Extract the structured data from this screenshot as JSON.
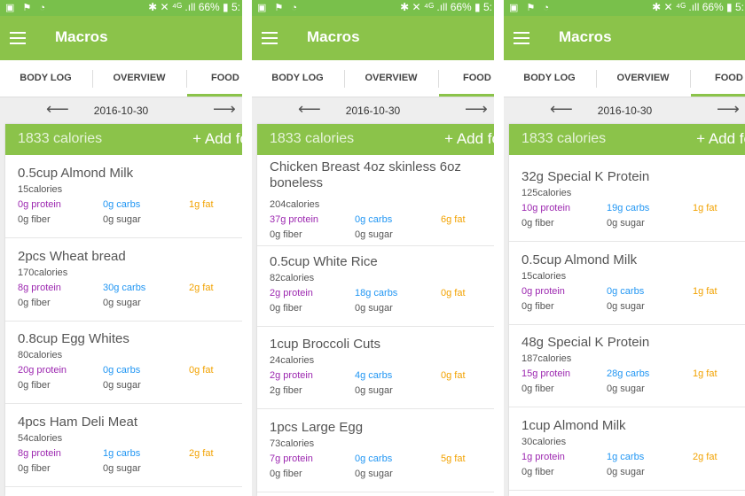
{
  "status": {
    "left_icons": "▣ ⚑ ◔",
    "right": "✱ ✕ ⁴ᴳ .ıll 66% ▮ 5:"
  },
  "app": {
    "title": "Macros"
  },
  "tabs": [
    "BODY LOG",
    "OVERVIEW",
    "FOOD L"
  ],
  "date": "2016-10-30",
  "header": {
    "calories": "1833 calories",
    "add_food": "+ Add fo"
  },
  "panels": [
    {
      "items": [
        {
          "name": "0.5cup  Almond Milk",
          "calories": "15calories",
          "protein": "0g protein",
          "carbs": "0g carbs",
          "fat": "1g fat",
          "fiber": "0g fiber",
          "sugar": "0g sugar"
        },
        {
          "name": "2pcs  Wheat bread",
          "calories": "170calories",
          "protein": "8g protein",
          "carbs": "30g carbs",
          "fat": "2g fat",
          "fiber": "0g fiber",
          "sugar": "0g sugar"
        },
        {
          "name": "0.8cup  Egg Whites",
          "calories": "80calories",
          "protein": "20g protein",
          "carbs": "0g carbs",
          "fat": "0g fat",
          "fiber": "0g fiber",
          "sugar": "0g sugar"
        },
        {
          "name": "4pcs  Ham Deli Meat",
          "calories": "54calories",
          "protein": "8g protein",
          "carbs": "1g carbs",
          "fat": "2g fat",
          "fiber": "0g fiber",
          "sugar": "0g sugar"
        }
      ]
    },
    {
      "items": [
        {
          "name": "      Chicken Breast 4oz skinless 6oz  boneless",
          "calories": "204calories",
          "protein": "37g protein",
          "carbs": "0g carbs",
          "fat": "6g fat",
          "fiber": "0g fiber",
          "sugar": "0g sugar"
        },
        {
          "name": "0.5cup  White Rice",
          "calories": "82calories",
          "protein": "2g protein",
          "carbs": "18g carbs",
          "fat": "0g fat",
          "fiber": "0g fiber",
          "sugar": "0g sugar"
        },
        {
          "name": "1cup  Broccoli Cuts",
          "calories": "24calories",
          "protein": "2g protein",
          "carbs": "4g carbs",
          "fat": "0g fat",
          "fiber": "2g fiber",
          "sugar": "0g sugar"
        },
        {
          "name": "1pcs  Large Egg",
          "calories": "73calories",
          "protein": "7g protein",
          "carbs": "0g carbs",
          "fat": "5g fat",
          "fiber": "0g fiber",
          "sugar": "0g sugar"
        }
      ]
    },
    {
      "items": [
        {
          "name": "32g  Special K Protein",
          "calories": "125calories",
          "protein": "10g protein",
          "carbs": "19g carbs",
          "fat": "1g fat",
          "fiber": "0g fiber",
          "sugar": "0g sugar"
        },
        {
          "name": "0.5cup  Almond Milk",
          "calories": "15calories",
          "protein": "0g protein",
          "carbs": "0g carbs",
          "fat": "1g fat",
          "fiber": "0g fiber",
          "sugar": "0g sugar"
        },
        {
          "name": "48g  Special K Protein",
          "calories": "187calories",
          "protein": "15g protein",
          "carbs": "28g carbs",
          "fat": "1g fat",
          "fiber": "0g fiber",
          "sugar": "0g sugar"
        },
        {
          "name": "1cup  Almond Milk",
          "calories": "30calories",
          "protein": "1g protein",
          "carbs": "1g carbs",
          "fat": "2g fat",
          "fiber": "0g fiber",
          "sugar": "0g sugar"
        }
      ]
    }
  ]
}
